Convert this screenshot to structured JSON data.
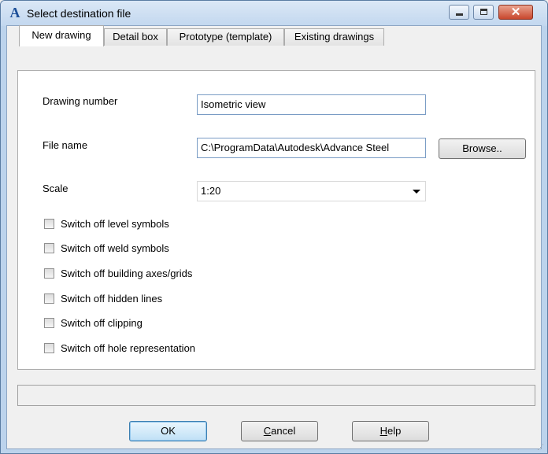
{
  "window": {
    "title": "Select destination file",
    "app_icon_glyph": "A",
    "close_glyph": "✕"
  },
  "tabs": [
    {
      "label": "New drawing",
      "active": true
    },
    {
      "label": "Detail box",
      "active": false
    },
    {
      "label": "Prototype (template)",
      "active": false
    },
    {
      "label": "Existing drawings",
      "active": false
    }
  ],
  "form": {
    "drawing_number_label": "Drawing number",
    "drawing_number_value": "Isometric view",
    "file_name_label": "File name",
    "file_name_value": "C:\\ProgramData\\Autodesk\\Advance Steel",
    "browse_label": "Browse..",
    "scale_label": "Scale",
    "scale_value": "1:20"
  },
  "checkboxes": [
    {
      "label": "Switch off level symbols",
      "checked": false
    },
    {
      "label": "Switch off weld symbols",
      "checked": false
    },
    {
      "label": "Switch off building axes/grids",
      "checked": false
    },
    {
      "label": "Switch off hidden lines",
      "checked": false
    },
    {
      "label": "Switch off clipping",
      "checked": false
    },
    {
      "label": "Switch off hole representation",
      "checked": false
    }
  ],
  "status_text": "",
  "buttons": {
    "ok": "OK",
    "cancel_first": "C",
    "cancel_rest": "ancel",
    "help_first": "H",
    "help_rest": "elp"
  },
  "colors": {
    "titlebar": "#c2d7ef",
    "close_button": "#c8472d",
    "accent": "#3c7fb1"
  }
}
